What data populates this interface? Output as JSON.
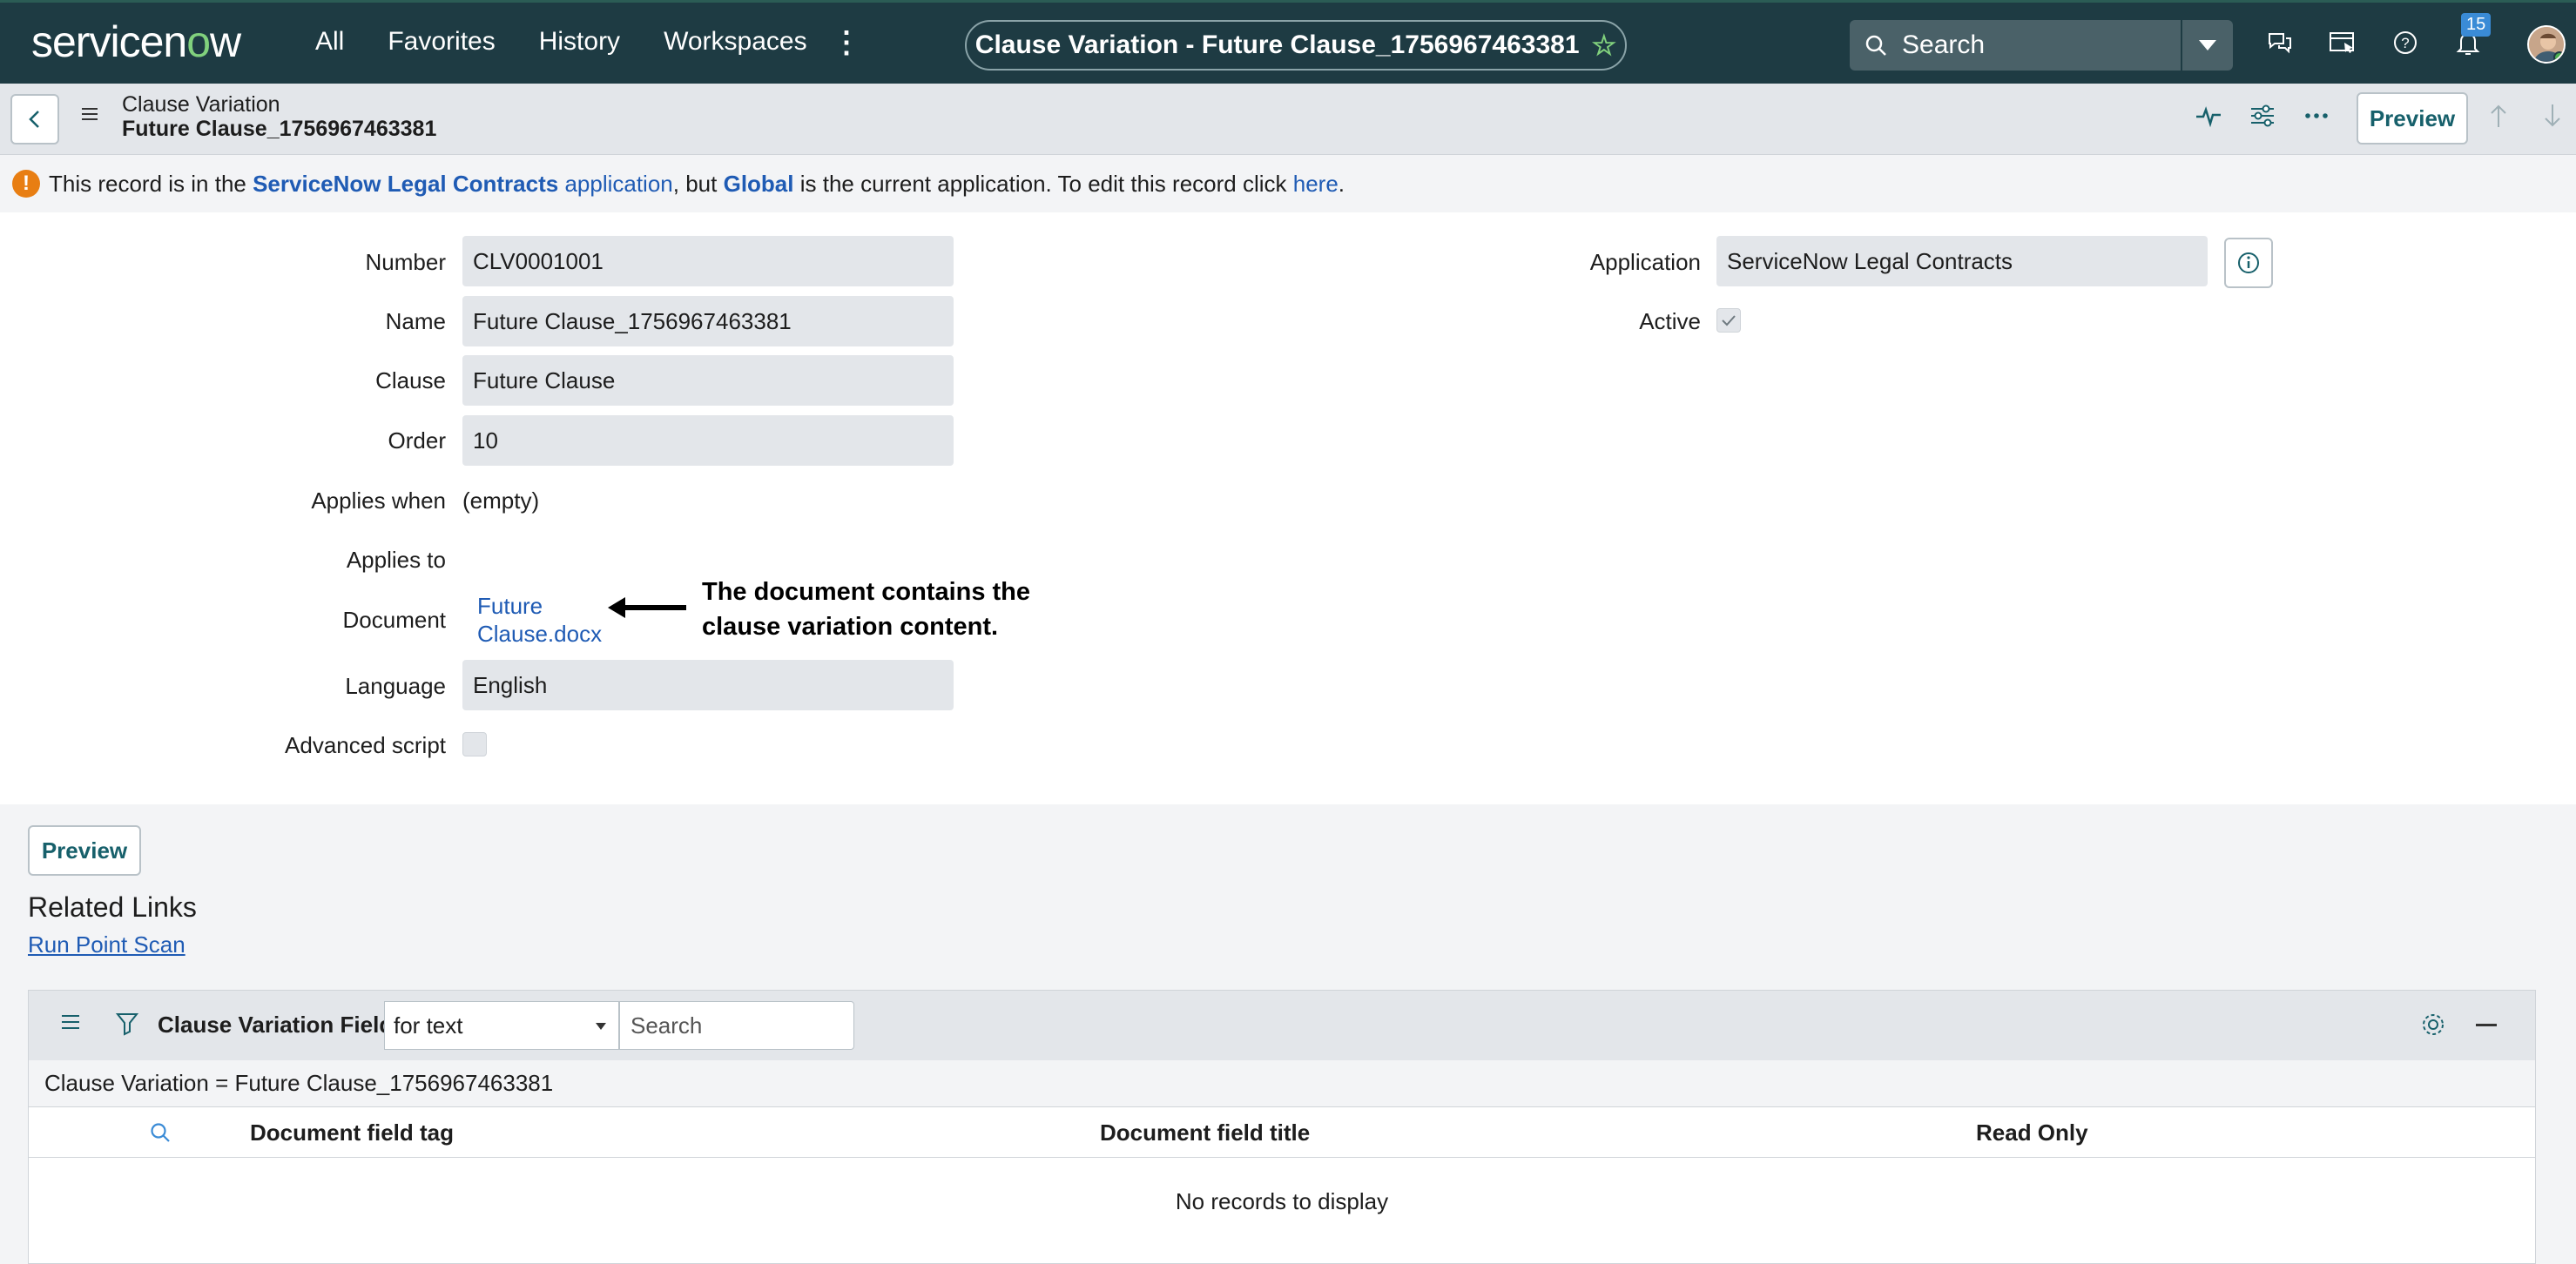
{
  "nav": {
    "logo_text_1": "servicen",
    "logo_text_o": "o",
    "logo_text_2": "w",
    "menu": [
      "All",
      "Favorites",
      "History",
      "Workspaces"
    ],
    "context_title": "Clause Variation - Future Clause_1756967463381",
    "search_placeholder": "Search",
    "notification_count": "15"
  },
  "record": {
    "table_label": "Clause Variation",
    "record_name": "Future Clause_1756967463381",
    "preview_label": "Preview"
  },
  "message": {
    "part1": "This record is in the ",
    "app_name": "ServiceNow Legal Contracts",
    "app_word": " application",
    "part2": ", but ",
    "global": "Global",
    "part3": " is the current application. To edit this record click ",
    "here": "here",
    "part4": "."
  },
  "form": {
    "number_label": "Number",
    "number_value": "CLV0001001",
    "name_label": "Name",
    "name_value": "Future Clause_1756967463381",
    "clause_label": "Clause",
    "clause_value": "Future Clause",
    "order_label": "Order",
    "order_value": "10",
    "applies_when_label": "Applies when",
    "applies_when_value": "(empty)",
    "applies_to_label": "Applies to",
    "document_label": "Document",
    "document_link_1": "Future",
    "document_link_2": "Clause.docx",
    "language_label": "Language",
    "language_value": "English",
    "advanced_script_label": "Advanced script",
    "application_label": "Application",
    "application_value": "ServiceNow Legal Contracts",
    "active_label": "Active",
    "active_checked": true
  },
  "annotation": {
    "line1": "The document contains the",
    "line2": "clause variation content."
  },
  "lower": {
    "preview_label": "Preview",
    "related_links_title": "Related Links",
    "run_point_scan": "Run Point Scan"
  },
  "related_list": {
    "title": "Clause Variation Fields",
    "filter_select": "for text",
    "search_placeholder": "Search",
    "breadcrumb": "Clause Variation = Future Clause_1756967463381",
    "columns": [
      "Document field tag",
      "Document field title",
      "Read Only"
    ],
    "empty_text": "No records to display"
  },
  "colors": {
    "nav_bg": "#1e3b43",
    "accent_green": "#81d17d",
    "link_blue": "#1f5bb4",
    "warning_orange": "#e87e13"
  }
}
